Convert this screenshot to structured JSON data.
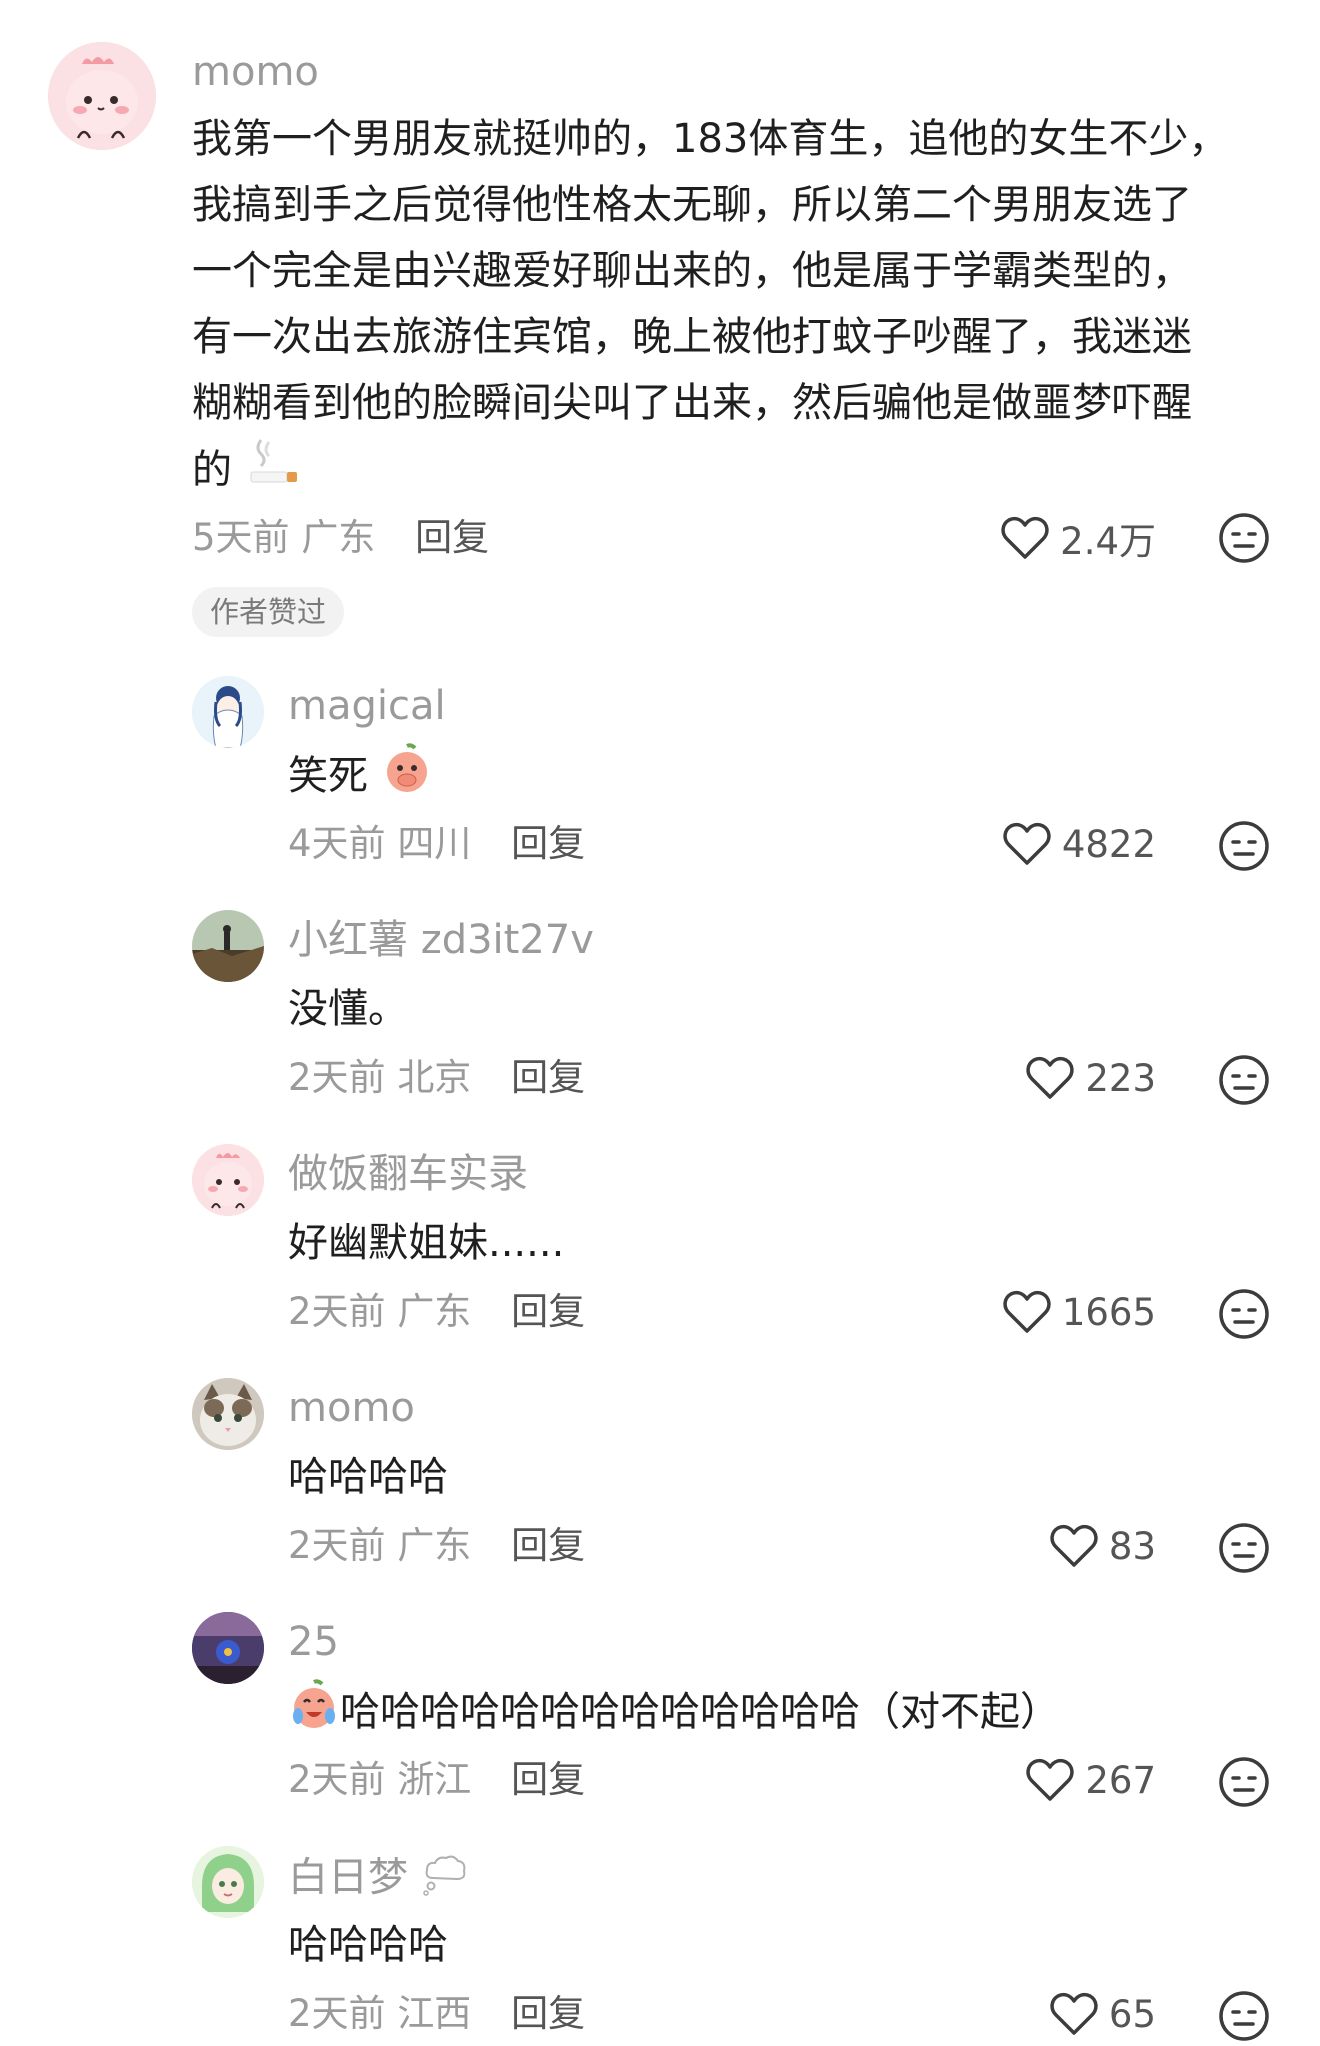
{
  "main_comment": {
    "author": "momo",
    "text_lines": [
      "我第一个男朋友就挺帅的，183体育生，追他的女生不少，",
      "我搞到手之后觉得他性格太无聊，所以第二个男朋友选了",
      "一个完全是由兴趣爱好聊出来的，他是属于学霸类型的，",
      "有一次出去旅游住宾馆，晚上被他打蚊子吵醒了，我迷迷",
      "糊糊看到他的脸瞬间尖叫了出来，然后骗他是做噩梦吓醒",
      "的"
    ],
    "time": "5天前",
    "location": "广东",
    "reply_label": "回复",
    "likes": "2.4万",
    "badge": "作者赞过",
    "trailing_icon": "cigarette-emoji"
  },
  "replies": [
    {
      "author": "magical",
      "text": "笑死",
      "emoji": "peach-cover-mouth-emoji",
      "time": "4天前",
      "location": "四川",
      "reply_label": "回复",
      "likes": "4822"
    },
    {
      "author": "小红薯 zd3it27v",
      "text": "没懂。",
      "time": "2天前",
      "location": "北京",
      "reply_label": "回复",
      "likes": "223"
    },
    {
      "author": "做饭翻车实录",
      "text": "好幽默姐妹......",
      "time": "2天前",
      "location": "广东",
      "reply_label": "回复",
      "likes": "1665"
    },
    {
      "author": "momo",
      "text": "哈哈哈哈",
      "time": "2天前",
      "location": "广东",
      "reply_label": "回复",
      "likes": "83"
    },
    {
      "author": "25",
      "text": "哈哈哈哈哈哈哈哈哈哈哈哈哈（对不起）",
      "emoji": "peach-laugh-cry-emoji",
      "time": "2天前",
      "location": "浙江",
      "reply_label": "回复",
      "likes": "267"
    },
    {
      "author": "白日梦",
      "author_icon": "thought-bubble-emoji",
      "text": "哈哈哈哈",
      "time": "2天前",
      "location": "江西",
      "reply_label": "回复",
      "likes": "65"
    }
  ],
  "icons": {
    "like": "heart-outline-icon",
    "dislike": "neutral-face-icon"
  },
  "colors": {
    "text": "#1f1f1f",
    "secondary": "#9a9a9a",
    "reply": "#555555"
  }
}
